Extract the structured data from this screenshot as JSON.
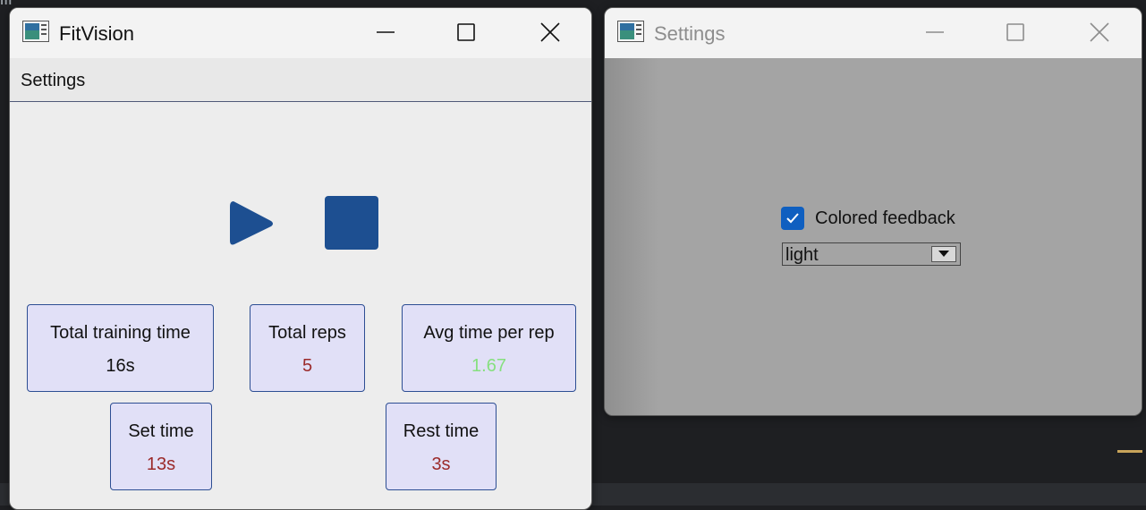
{
  "main_window": {
    "title": "FitVision",
    "menu": [
      "Settings"
    ],
    "controls": {
      "play_icon": "play-icon",
      "stop_icon": "stop-icon"
    },
    "stats": {
      "total_training_time": {
        "label": "Total training time",
        "value": "16s",
        "value_color": "#111111"
      },
      "total_reps": {
        "label": "Total reps",
        "value": "5",
        "value_color": "#9b2a2a"
      },
      "avg_time_per_rep": {
        "label": "Avg time per rep",
        "value": "1.67",
        "value_color": "#86e07f"
      },
      "set_time": {
        "label": "Set time",
        "value": "13s",
        "value_color": "#9b2a2a"
      },
      "rest_time": {
        "label": "Rest time",
        "value": "3s",
        "value_color": "#9b2a2a"
      }
    },
    "colors": {
      "accent": "#1d4f91",
      "card_bg": "#e1e0f7",
      "card_border": "#2d4e93"
    }
  },
  "settings_window": {
    "title": "Settings",
    "colored_feedback": {
      "label": "Colored feedback",
      "checked": true
    },
    "theme_select": {
      "value": "light"
    }
  }
}
